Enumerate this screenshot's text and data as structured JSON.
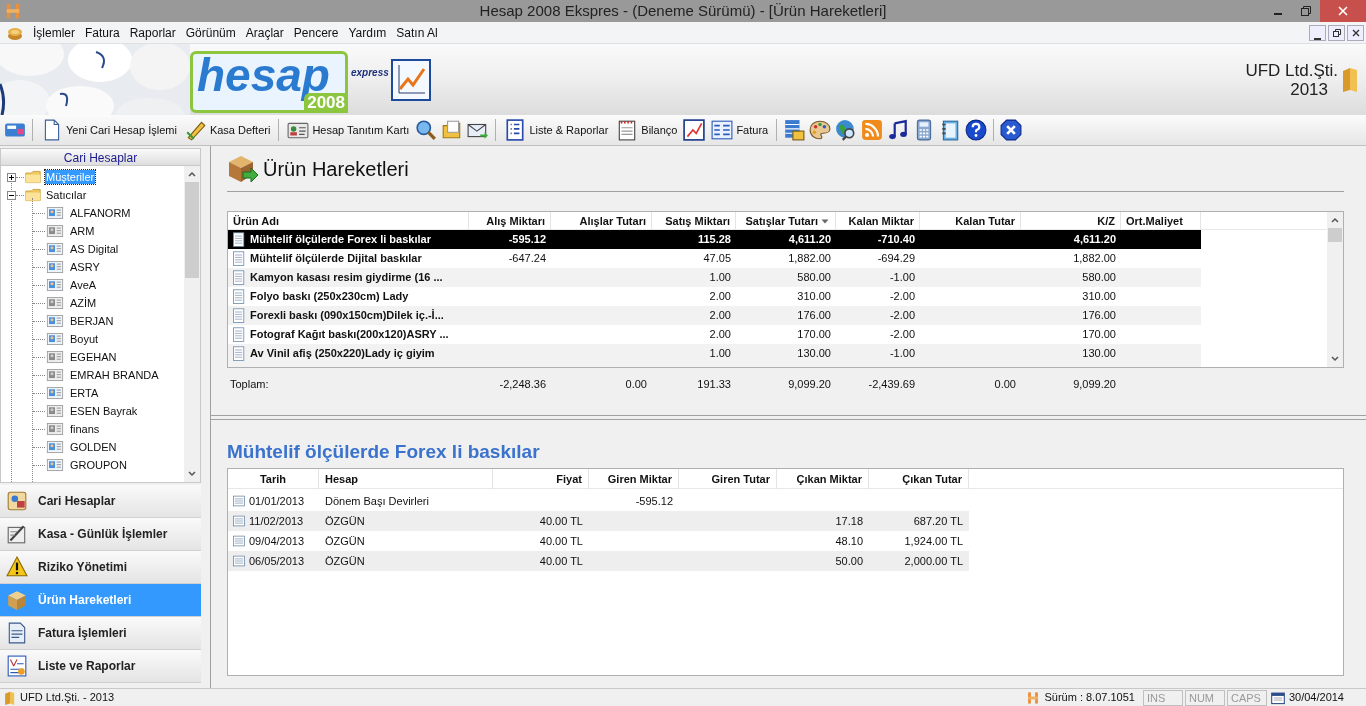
{
  "window": {
    "title": "Hesap 2008 Ekspres - (Deneme Sürümü) - [Ürün Hareketleri]"
  },
  "menu": [
    {
      "label": "İşlemler"
    },
    {
      "label": "Fatura"
    },
    {
      "label": "Raporlar"
    },
    {
      "label": "Görünüm"
    },
    {
      "label": "Araçlar"
    },
    {
      "label": "Pencere"
    },
    {
      "label": "Yardım"
    },
    {
      "label": "Satın Al"
    }
  ],
  "banner": {
    "logo_word": "hesap",
    "logo_year": "2008",
    "logo_edition": "express",
    "company": "UFD Ltd.Şti.",
    "year": "2013"
  },
  "toolbar": [
    {
      "kind": "button"
    },
    {
      "kind": "separator"
    },
    {
      "kind": "button",
      "label": "Yeni Cari Hesap İşlemi"
    },
    {
      "kind": "button",
      "label": "Kasa Defteri"
    },
    {
      "kind": "separator"
    },
    {
      "kind": "button",
      "label": "Hesap Tanıtım Kartı"
    },
    {
      "kind": "button"
    },
    {
      "kind": "button"
    },
    {
      "kind": "button"
    },
    {
      "kind": "separator"
    },
    {
      "kind": "button",
      "label": "Liste & Raporlar"
    },
    {
      "kind": "button",
      "label": "Bilanço"
    },
    {
      "kind": "button"
    },
    {
      "kind": "button",
      "label": "Fatura"
    },
    {
      "kind": "separator"
    },
    {
      "kind": "button"
    },
    {
      "kind": "button"
    },
    {
      "kind": "button"
    },
    {
      "kind": "button"
    },
    {
      "kind": "button"
    },
    {
      "kind": "button"
    },
    {
      "kind": "button"
    },
    {
      "kind": "button"
    },
    {
      "kind": "separator"
    },
    {
      "kind": "button"
    }
  ],
  "sidebar": {
    "header": "Cari Hesaplar",
    "tree": [
      {
        "label": "Müşteriler",
        "expanded": false,
        "selected": true
      },
      {
        "label": "Satıcılar",
        "expanded": true,
        "selected": false,
        "children": [
          {
            "label": "ALFANORM",
            "active": true
          },
          {
            "label": "ARM",
            "active": false
          },
          {
            "label": "AS Digital",
            "active": true
          },
          {
            "label": "ASRY",
            "active": true
          },
          {
            "label": "AveA",
            "active": true
          },
          {
            "label": "AZİM",
            "active": false
          },
          {
            "label": "BERJAN",
            "active": true
          },
          {
            "label": "Boyut",
            "active": true
          },
          {
            "label": "EGEHAN",
            "active": false
          },
          {
            "label": "EMRAH BRANDA",
            "active": false
          },
          {
            "label": "ERTA",
            "active": true
          },
          {
            "label": "ESEN Bayrak",
            "active": false
          },
          {
            "label": "finans",
            "active": false
          },
          {
            "label": "GOLDEN",
            "active": true
          },
          {
            "label": "GROUPON",
            "active": true
          }
        ]
      }
    ],
    "nav": [
      {
        "label": "Cari Hesaplar",
        "selected": false
      },
      {
        "label": "Kasa - Günlük İşlemler",
        "selected": false
      },
      {
        "label": "Riziko Yönetimi",
        "selected": false
      },
      {
        "label": "Ürün Hareketleri",
        "selected": true
      },
      {
        "label": "Fatura İşlemleri",
        "selected": false
      },
      {
        "label": "Liste ve Raporlar",
        "selected": false
      }
    ]
  },
  "page": {
    "title": "Ürün Hareketleri",
    "table": {
      "columns": [
        {
          "label": "Ürün Adı",
          "sorted": false
        },
        {
          "label": "Alış Miktarı",
          "sorted": false
        },
        {
          "label": "Alışlar Tutarı",
          "sorted": false
        },
        {
          "label": "Satış Miktarı",
          "sorted": false
        },
        {
          "label": "Satışlar Tutarı",
          "sorted": true
        },
        {
          "label": "Kalan Miktar",
          "sorted": false
        },
        {
          "label": "Kalan Tutar",
          "sorted": false
        },
        {
          "label": "K/Z",
          "sorted": false
        },
        {
          "label": "Ort.Maliyet",
          "sorted": false
        }
      ],
      "rows": [
        {
          "selected": true,
          "cells": [
            "Mühtelif ölçülerde Forex li baskılar",
            "-595.12",
            null,
            "115.28",
            "4,611.20",
            "-710.40",
            null,
            "4,611.20",
            null
          ]
        },
        {
          "selected": false,
          "cells": [
            "Mühtelif ölçülerde Dijital baskılar",
            "-647.24",
            null,
            "47.05",
            "1,882.00",
            "-694.29",
            null,
            "1,882.00",
            null
          ]
        },
        {
          "selected": false,
          "cells": [
            "Kamyon kasası resim giydirme (16 ...",
            null,
            null,
            "1.00",
            "580.00",
            "-1.00",
            null,
            "580.00",
            null
          ]
        },
        {
          "selected": false,
          "cells": [
            "Folyo baskı (250x230cm) Lady",
            null,
            null,
            "2.00",
            "310.00",
            "-2.00",
            null,
            "310.00",
            null
          ]
        },
        {
          "selected": false,
          "cells": [
            "Forexli baskı (090x150cm)Dilek iç.-İ...",
            null,
            null,
            "2.00",
            "176.00",
            "-2.00",
            null,
            "176.00",
            null
          ]
        },
        {
          "selected": false,
          "cells": [
            "Fotograf Kağıt baskı(200x120)ASRY ...",
            null,
            null,
            "2.00",
            "170.00",
            "-2.00",
            null,
            "170.00",
            null
          ]
        },
        {
          "selected": false,
          "cells": [
            "Av Vinil afiş (250x220)Lady iç giyim",
            null,
            null,
            "1.00",
            "130.00",
            "-1.00",
            null,
            "130.00",
            null
          ]
        }
      ],
      "totals": {
        "label": "Toplam:",
        "values": [
          "-2,248.36",
          "0.00",
          "191.33",
          "9,099.20",
          "-2,439.69",
          "0.00",
          "9,099.20"
        ]
      }
    },
    "detail": {
      "title": "Mühtelif ölçülerde Forex li baskılar",
      "columns": [
        "Tarih",
        "Hesap",
        "Fiyat",
        "Giren Miktar",
        "Giren Tutar",
        "Çıkan Miktar",
        "Çıkan Tutar"
      ],
      "rows": [
        [
          "01/01/2013",
          "Dönem Başı Devirleri",
          null,
          "-595.12",
          null,
          null,
          null
        ],
        [
          "11/02/2013",
          "ÖZGÜN",
          "40.00 TL",
          null,
          null,
          "17.18",
          "687.20 TL"
        ],
        [
          "09/04/2013",
          "ÖZGÜN",
          "40.00 TL",
          null,
          null,
          "48.10",
          "1,924.00 TL"
        ],
        [
          "06/05/2013",
          "ÖZGÜN",
          "40.00 TL",
          null,
          null,
          "50.00",
          "2,000.00 TL"
        ]
      ]
    }
  },
  "status_bar": {
    "company": "UFD Ltd.Şti. - 2013",
    "version": "Sürüm : 8.07.1051",
    "keys": [
      {
        "label": "INS",
        "on": false
      },
      {
        "label": "NUM",
        "on": false
      },
      {
        "label": "CAPS",
        "on": false
      }
    ],
    "date": "30/04/2014"
  }
}
